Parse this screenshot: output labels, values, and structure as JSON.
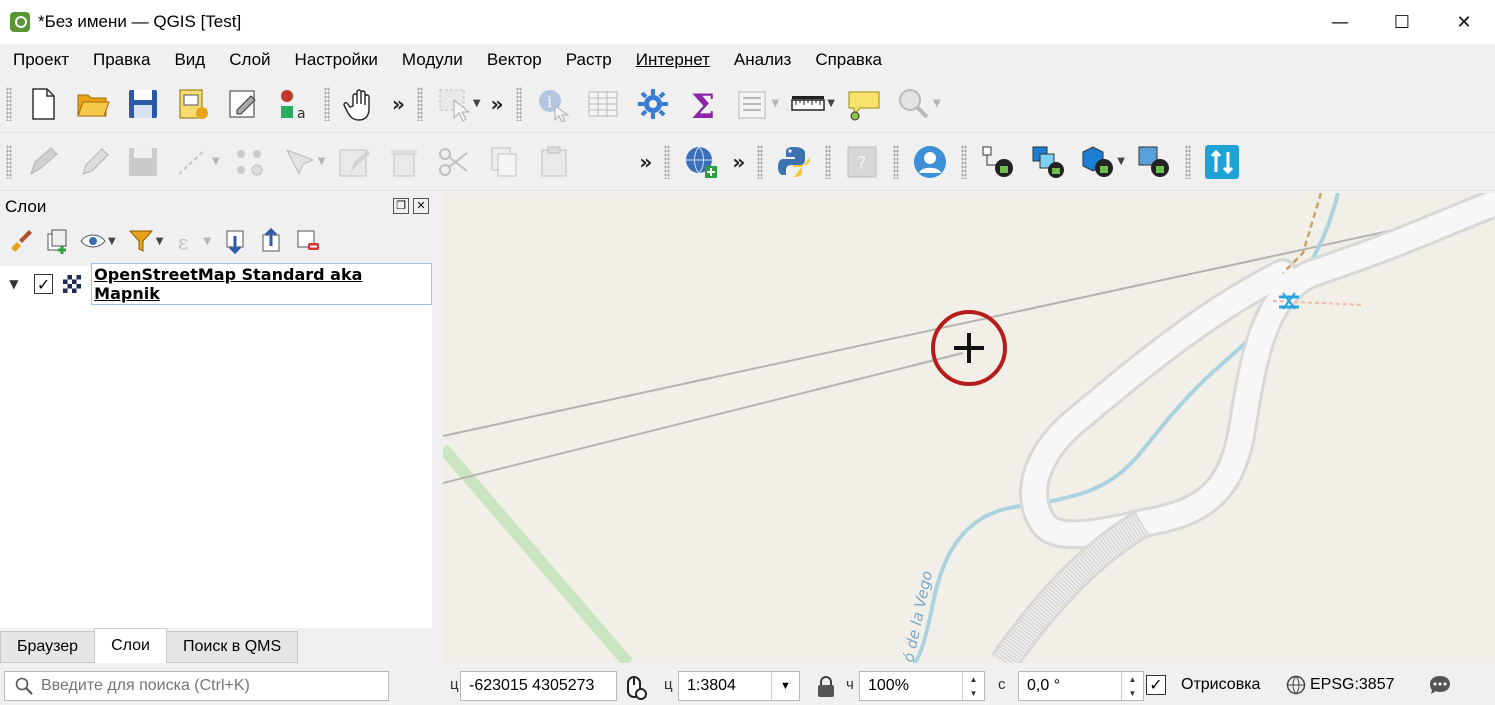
{
  "window": {
    "title": "*Без имени — QGIS [Test]",
    "controls": {
      "minimize": "—",
      "maximize": "☐",
      "close": "✕"
    }
  },
  "menu": [
    "Проект",
    "Правка",
    "Вид",
    "Слой",
    "Настройки",
    "Модули",
    "Вектор",
    "Растр",
    "Интернет",
    "Анализ",
    "Справка"
  ],
  "toolbar1": {
    "overflow": "»",
    "icons": [
      "new-project-icon",
      "open-project-icon",
      "save-project-icon",
      "print-layout-icon",
      "layout-manager-icon",
      "style-manager-icon",
      "pan-icon",
      "select-features-icon",
      "identify-icon",
      "attribute-table-icon",
      "toolbox-icon",
      "statistics-icon",
      "open-field-calc-icon",
      "measure-icon",
      "map-tips-icon",
      "zoom-actions-icon"
    ]
  },
  "toolbar2": {
    "overflow": "»",
    "icons": [
      "edits-icon",
      "toggle-editing-icon",
      "save-edits-icon",
      "digitize-icon",
      "vertex-tool-icon",
      "modify-attributes-icon",
      "delete-icon",
      "cut-icon",
      "copy-icon",
      "paste-icon",
      "add-wms-icon",
      "python-console-icon",
      "help-icon",
      "user-icon",
      "geo-lock-icons",
      "sort-icon"
    ]
  },
  "layers_panel": {
    "title": "Слои",
    "layers": [
      {
        "name": "OpenStreetMap Standard aka Mapnik",
        "checked": "✓"
      }
    ],
    "tabs": [
      "Браузер",
      "Слои",
      "Поиск в QMS"
    ],
    "active_tab": "Слои"
  },
  "map": {
    "label": "ó de la Vego",
    "colors": {
      "background": "#f2efe9",
      "river": "#aad3df",
      "road": "#ffffff",
      "power_line": "#aaa9a6"
    }
  },
  "statusbar": {
    "search_placeholder": "Введите для поиска (Ctrl+K)",
    "coord_label": "ц",
    "coordinate": "-623015  4305273",
    "scale_label": "ц",
    "scale": "1:3804",
    "magnifier_label": "ч",
    "magnifier": "100%",
    "rotation_label": "с",
    "rotation": "0,0 °",
    "render_label": "Отрисовка",
    "render_checked": "✓",
    "crs": "EPSG:3857"
  }
}
